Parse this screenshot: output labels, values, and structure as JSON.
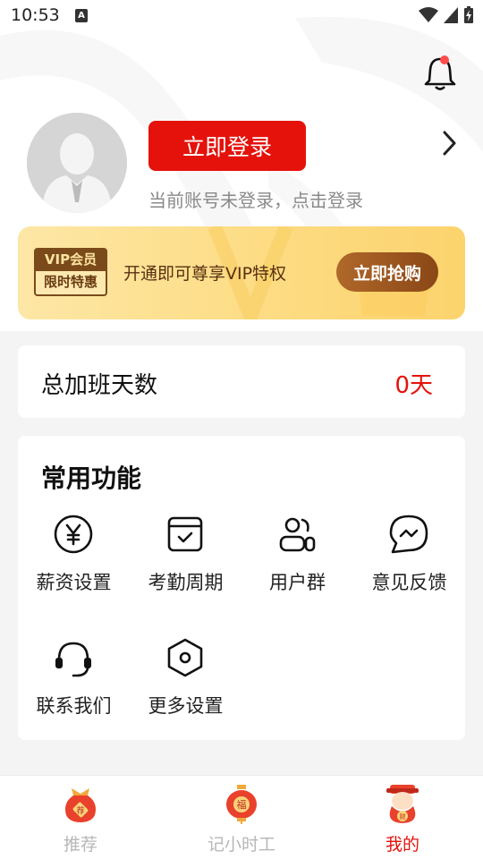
{
  "status_bar": {
    "time": "10:53",
    "notification_letter": "A"
  },
  "profile": {
    "login_button": "立即登录",
    "login_hint": "当前账号未登录，点击登录"
  },
  "vip_banner": {
    "badge_top": "VIP会员",
    "badge_bottom": "限时特惠",
    "text": "开通即可尊享VIP特权",
    "button": "立即抢购"
  },
  "overtime": {
    "label": "总加班天数",
    "value": "0天"
  },
  "functions": {
    "title": "常用功能",
    "items": [
      {
        "label": "薪资设置",
        "icon": "yen-circle-icon"
      },
      {
        "label": "考勤周期",
        "icon": "calendar-check-icon"
      },
      {
        "label": "用户群",
        "icon": "user-group-icon"
      },
      {
        "label": "意见反馈",
        "icon": "feedback-chat-icon"
      },
      {
        "label": "联系我们",
        "icon": "headset-icon"
      },
      {
        "label": "更多设置",
        "icon": "hexagon-settings-icon"
      }
    ]
  },
  "tabbar": {
    "tabs": [
      {
        "label": "推荐",
        "icon": "lucky-bag-icon",
        "active": false
      },
      {
        "label": "记小时工",
        "icon": "fu-lantern-icon",
        "active": false
      },
      {
        "label": "我的",
        "icon": "fortune-god-icon",
        "active": true
      }
    ]
  },
  "colors": {
    "accent": "#e4120b",
    "vip_brown": "#8a4716",
    "vip_gold": "#fddc84"
  }
}
